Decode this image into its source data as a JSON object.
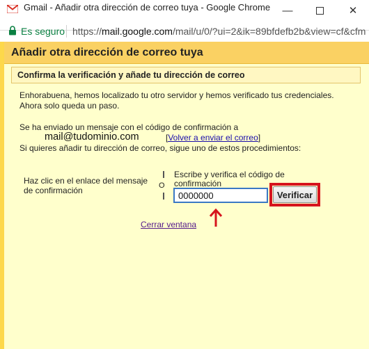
{
  "window": {
    "title": "Gmail - Añadir otra dirección de correo tuya - Google Chrome",
    "minimize": "—",
    "close": "✕"
  },
  "address_bar": {
    "secure_label": "Es seguro",
    "url_scheme": "https://",
    "url_host": "mail.google.com",
    "url_path": "/mail/u/0/?ui=2&ik=89bfdefb2b&view=cf&cfm"
  },
  "dialog": {
    "title": "Añadir otra dirección de correo tuya",
    "section_title": "Confirma la verificación y añade tu dirección de correo",
    "congrats_line1": "Enhorabuena, hemos localizado tu otro servidor y hemos verificado tus credenciales.",
    "congrats_line2": "Ahora solo queda un paso.",
    "sent_message": "Se ha enviado un mensaje con el código de confirmación a",
    "email": "mail@tudominio.com",
    "resend_open": "[",
    "resend_link": "Volver a enviar el correo",
    "resend_close": "]",
    "alternative_message": "Si quieres añadir tu dirección de correo, sigue uno de estos procedimientos:",
    "option_click_line1": "Haz clic en el enlace del mensaje",
    "option_click_line2": "de confirmación",
    "separator": "O",
    "option_code_line1": "Escribe y verifica el código de",
    "option_code_line2": "confirmación",
    "code_value": "0000000",
    "verify_button": "Verificar",
    "close_link": "Cerrar ventana"
  },
  "colors": {
    "header_gold": "#fad163",
    "page_bg": "#ffffcc",
    "highlight_red": "#d6141d",
    "secure_green": "#0b8043"
  }
}
